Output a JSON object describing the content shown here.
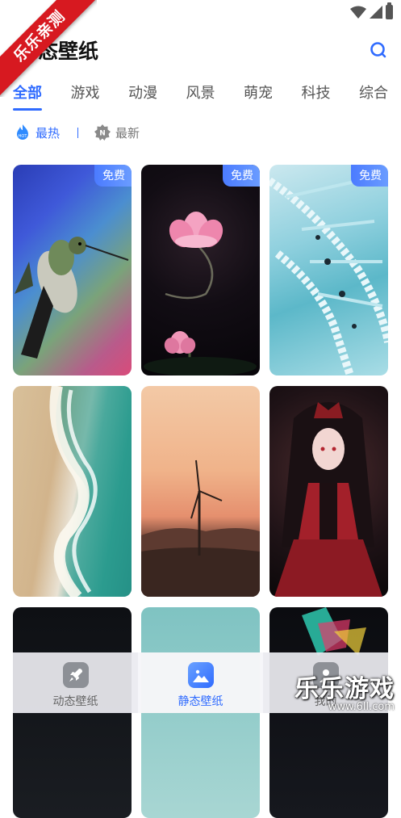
{
  "app": {
    "title": "静态壁纸",
    "ribbon": "乐乐亲测"
  },
  "tabs": [
    {
      "label": "全部",
      "active": true
    },
    {
      "label": "游戏",
      "active": false
    },
    {
      "label": "动漫",
      "active": false
    },
    {
      "label": "风景",
      "active": false
    },
    {
      "label": "萌宠",
      "active": false
    },
    {
      "label": "科技",
      "active": false
    },
    {
      "label": "综合",
      "active": false
    }
  ],
  "sort": {
    "hot": {
      "label": "最热",
      "icon": "hot-flame-icon"
    },
    "new": {
      "label": "最新",
      "icon": "new-badge-icon"
    }
  },
  "badge_free": "免费",
  "wallpapers": [
    {
      "subject": "hummingbird"
    },
    {
      "subject": "lotus"
    },
    {
      "subject": "dna-helix"
    },
    {
      "subject": "beach-wave"
    },
    {
      "subject": "wind-turbine"
    },
    {
      "subject": "gothic-girl"
    },
    {
      "subject": "dark"
    },
    {
      "subject": "teal"
    },
    {
      "subject": "abstract"
    }
  ],
  "bottom_nav": [
    {
      "label": "动态壁纸",
      "icon": "rocket-icon",
      "active": false
    },
    {
      "label": "静态壁纸",
      "icon": "image-icon",
      "active": true
    },
    {
      "label": "我的",
      "icon": "user-icon",
      "active": false
    }
  ],
  "watermark": {
    "title": "乐乐游戏",
    "url": "www.6ll.com"
  },
  "colors": {
    "accent": "#2f6bff",
    "ribbon": "#d71920",
    "badge": "#4b7bff"
  }
}
